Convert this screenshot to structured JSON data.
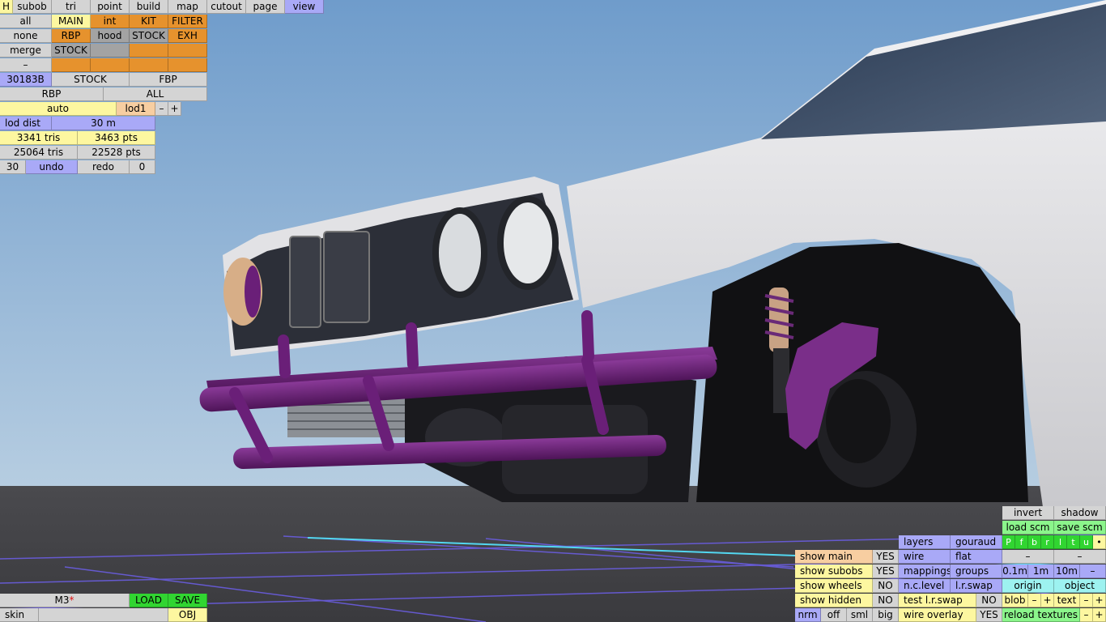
{
  "top_menu": [
    "H",
    "subob",
    "tri",
    "point",
    "build",
    "map",
    "cutout",
    "page",
    "view"
  ],
  "row_all": {
    "label": "all",
    "items": [
      "MAIN",
      "int",
      "KIT",
      "FILTER"
    ]
  },
  "row_none": {
    "label": "none",
    "items": [
      "RBP",
      "hood",
      "STOCK",
      "EXH"
    ]
  },
  "row_merge": {
    "label": "merge",
    "items": [
      "STOCK"
    ]
  },
  "row_minus": {
    "label": "–"
  },
  "info_row1": [
    "30183B",
    "STOCK",
    "FBP"
  ],
  "info_row2": [
    "RBP",
    "ALL"
  ],
  "lod_row": {
    "mode": "auto",
    "lod": "lod1",
    "minus": "–",
    "plus": "+"
  },
  "lod_dist": {
    "label": "lod dist",
    "value": "30 m"
  },
  "stats1": {
    "tris": "3341 tris",
    "pts": "3463 pts"
  },
  "stats2": {
    "tris": "25064 tris",
    "pts": "22528 pts"
  },
  "undo_row": {
    "count": "30",
    "undo": "undo",
    "redo": "redo",
    "redo_count": "0"
  },
  "bottom_left": {
    "name": "M3",
    "name_mark": "*",
    "load": "LOAD",
    "save": "SAVE",
    "skin": "skin",
    "obj": "OBJ"
  },
  "right_panel": {
    "invert": "invert",
    "shadow": "shadow",
    "load_scm": "load scm",
    "save_scm": "save scm",
    "flags": [
      "P",
      "f",
      "b",
      "r",
      "l",
      "t",
      "u",
      "•"
    ],
    "layers": "layers",
    "gouraud": "gouraud",
    "minus1": "–",
    "minus2": "–",
    "show_main": "show main",
    "show_main_val": "YES",
    "wire": "wire",
    "flat": "flat",
    "show_subobs": "show subobs",
    "show_subobs_val": "YES",
    "mappings": "mappings",
    "groups": "groups",
    "scale": [
      "0.1m",
      "1m",
      "10m",
      "–"
    ],
    "show_wheels": "show wheels",
    "show_wheels_val": "NO",
    "nc_level": "n.c.level",
    "lr_swap": "l.r.swap",
    "origin": "origin",
    "object": "object",
    "show_hidden": "show hidden",
    "show_hidden_val": "NO",
    "test_lr_swap": "test l.r.swap",
    "test_lr_swap_val": "NO",
    "blob": "blob",
    "blob_minus": "–",
    "blob_plus": "+",
    "text": "text",
    "text_minus": "–",
    "text_plus": "+",
    "view_modes": [
      "nrm",
      "off",
      "sml",
      "big"
    ],
    "wire_overlay": "wire overlay",
    "wire_overlay_val": "YES",
    "reload_textures": "reload textures",
    "reload_minus": "–",
    "reload_plus": "+"
  },
  "colors": {
    "accent": "#e6922d",
    "selected": "#a9a9f7",
    "yes_no": "#fdf7a0",
    "on": "#31d531"
  }
}
